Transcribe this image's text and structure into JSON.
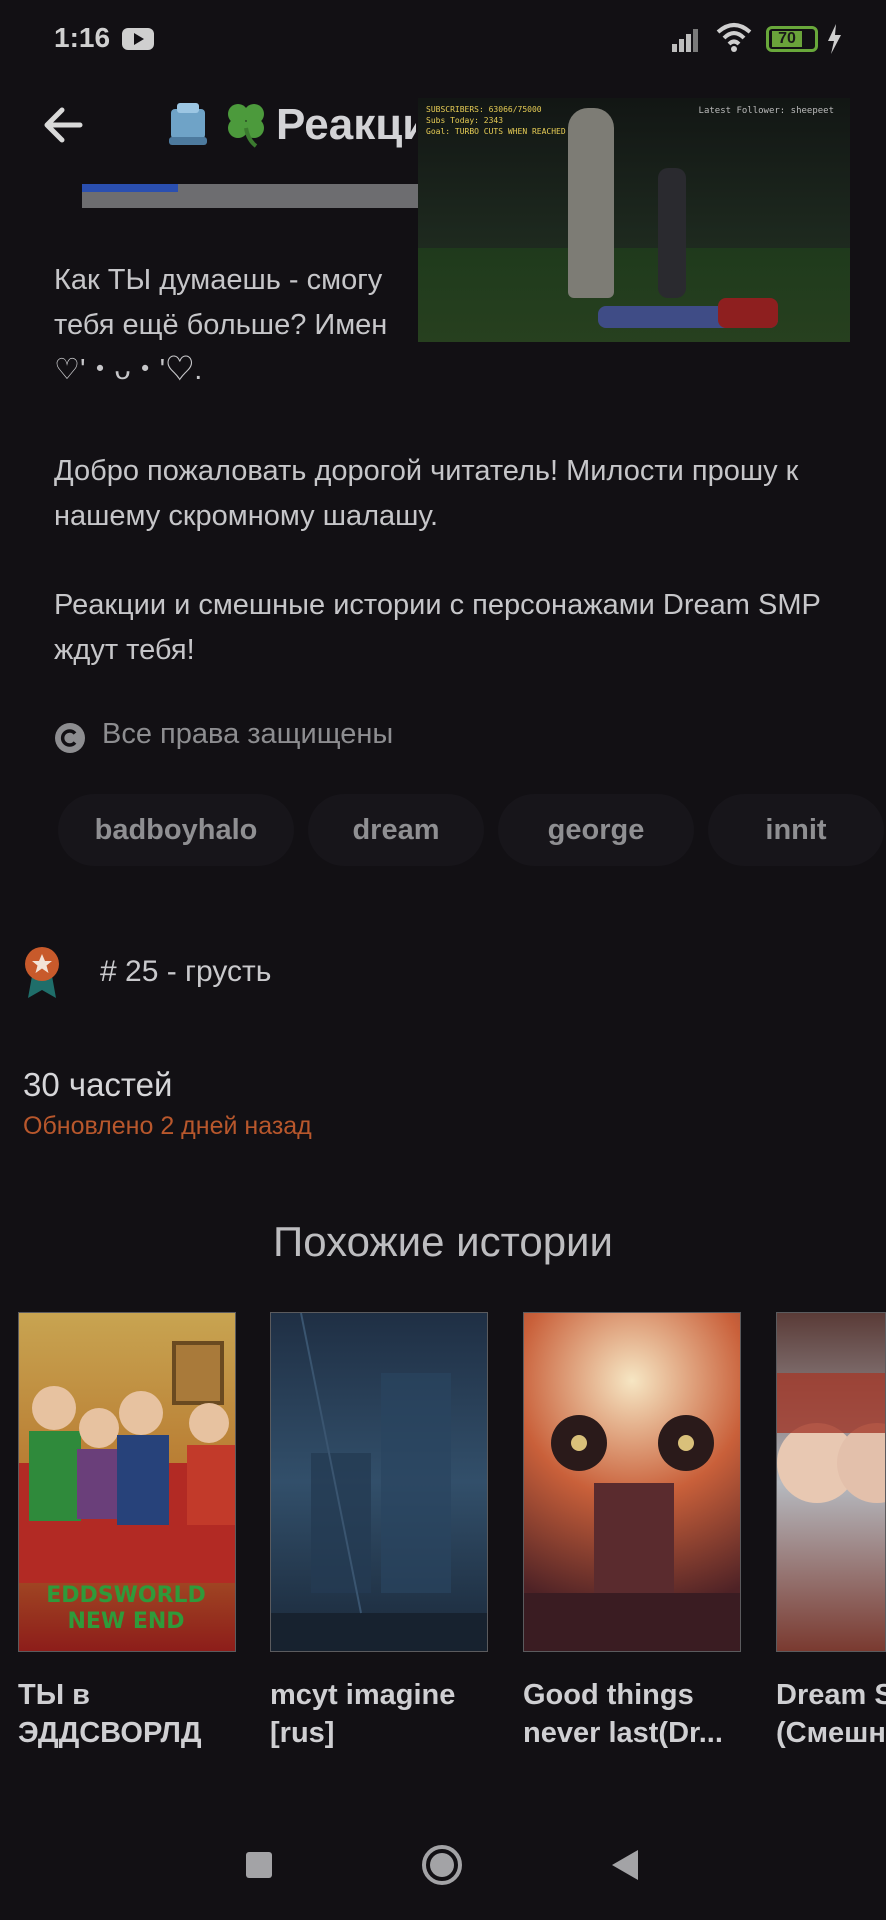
{
  "status_bar": {
    "time": "1:16",
    "battery": "70",
    "colors": {
      "battery": "#6aa33a"
    }
  },
  "header": {
    "title": "Реакци",
    "emoji_icons": [
      "ice-cube-icon",
      "clover-icon"
    ]
  },
  "video_overlay": {
    "hud_left": [
      "SUBSCRIBERS: 63066/75000",
      "Subs Today: 2343",
      "Goal: TURBO CUTS WHEN REACHED"
    ],
    "hud_right": "Latest Follower: sheepeet"
  },
  "description": {
    "para1_line1": "Как ТЫ думаешь - смогу",
    "para1_line2": "тебя ещё больше? Имен",
    "para1_line3": "♡'・ᴗ・'♡.",
    "para2": "Добро пожаловать дорогой читатель! Милости прошу к нашему скромному шалашу.",
    "para3": "Реакции и смешные истории с персонажами Dream SMP ждут тебя!"
  },
  "copyright": "Все права защищены",
  "tags": [
    "badboyhalo",
    "dream",
    "george",
    "innit"
  ],
  "ranking": {
    "label": "# 25 - грусть",
    "colors": {
      "badge": "#c85a2b"
    }
  },
  "parts": "30 частей",
  "updated": "Обновлено 2 дней назад",
  "similar": {
    "title": "Похожие истории",
    "cards": [
      {
        "title": "ТЫ в ЭДДСВОРЛД",
        "cover_text": "EDDSWORLD NEW END"
      },
      {
        "title": "mcyt imagine [rus]"
      },
      {
        "title": "Good things never last(Dr..."
      },
      {
        "title": "Dream S (Смешн"
      }
    ]
  },
  "nav": {
    "icons": [
      "recents-square-icon",
      "home-circle-icon",
      "back-triangle-icon"
    ]
  }
}
